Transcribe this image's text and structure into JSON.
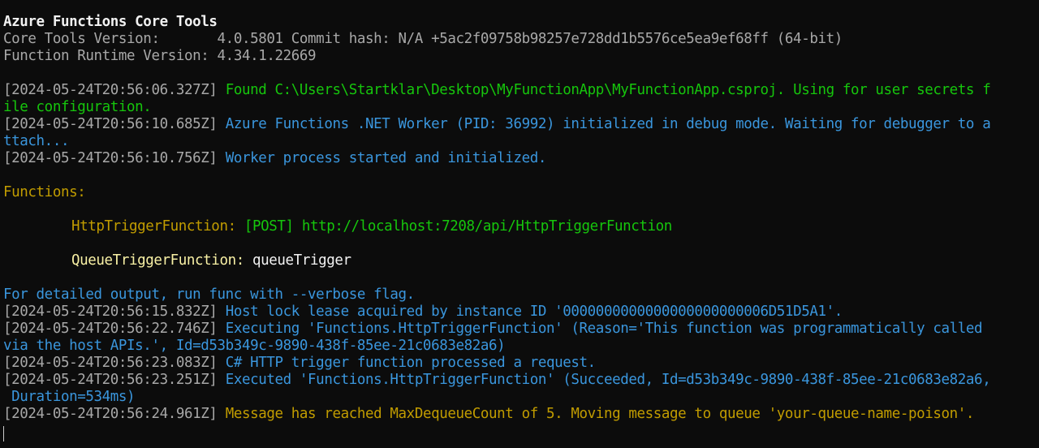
{
  "header": {
    "title": "Azure Functions Core Tools",
    "core_tools_label": "Core Tools Version:       ",
    "core_tools_value": "4.0.5801 Commit hash: N/A +5ac2f09758b98257e728dd1b5576ce5ea9ef68ff (64-bit)",
    "runtime_label": "Function Runtime Version: ",
    "runtime_value": "4.34.1.22669"
  },
  "log1": {
    "timestamp": "[2024-05-24T20:56:06.327Z]",
    "message": "Found C:\\Users\\Startklar\\Desktop\\MyFunctionApp\\MyFunctionApp.csproj. Using for user secrets f",
    "message_cont": "ile configuration."
  },
  "log2": {
    "timestamp": "[2024-05-24T20:56:10.685Z]",
    "message": "Azure Functions .NET Worker (PID: 36992) initialized in debug mode. Waiting for debugger to a",
    "message_cont": "ttach..."
  },
  "log3": {
    "timestamp": "[2024-05-24T20:56:10.756Z]",
    "message": "Worker process started and initialized."
  },
  "functions": {
    "heading": "Functions:",
    "items": [
      {
        "name": "HttpTriggerFunction:",
        "method": "[POST]",
        "url": "http://localhost:7208/api/HttpTriggerFunction"
      },
      {
        "name": "QueueTriggerFunction:",
        "trigger": "queueTrigger"
      }
    ]
  },
  "verbose_hint": "For detailed output, run func with --verbose flag.",
  "log4": {
    "timestamp": "[2024-05-24T20:56:15.832Z]",
    "message": "Host lock lease acquired by instance ID '0000000000000000000000006D51D5A1'."
  },
  "log5": {
    "timestamp": "[2024-05-24T20:56:22.746Z]",
    "message": "Executing 'Functions.HttpTriggerFunction' (Reason='This function was programmatically called",
    "message_cont": "via the host APIs.', Id=d53b349c-9890-438f-85ee-21c0683e82a6)"
  },
  "log6": {
    "timestamp": "[2024-05-24T20:56:23.083Z]",
    "message": "C# HTTP trigger function processed a request."
  },
  "log7": {
    "timestamp": "[2024-05-24T20:56:23.251Z]",
    "message": "Executed 'Functions.HttpTriggerFunction' (Succeeded, Id=d53b349c-9890-438f-85ee-21c0683e82a6,",
    "message_cont": " Duration=534ms)"
  },
  "log8": {
    "timestamp": "[2024-05-24T20:56:24.961Z]",
    "message": "Message has reached MaxDequeueCount of 5. Moving message to queue 'your-queue-name-poison'."
  },
  "colors": {
    "background": "#0c0c0c",
    "timestamp": "#a8a8a8",
    "info": "#3a96dd",
    "success": "#16c60c",
    "warning": "#c19c00",
    "function_name": "#f9f1a5"
  }
}
